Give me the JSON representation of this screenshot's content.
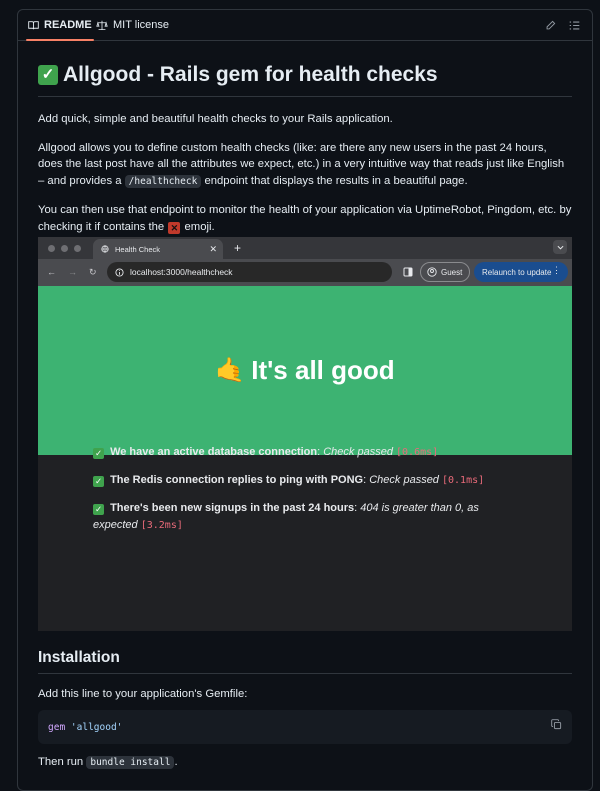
{
  "tabs": {
    "readme": "README",
    "license": "MIT license"
  },
  "readme": {
    "title": "Allgood - Rails gem for health checks",
    "p1": "Add quick, simple and beautiful health checks to your Rails application.",
    "p2a": "Allgood allows you to define custom health checks (like: are there any new users in the past 24 hours, does the last post have all the attributes we expect, etc.) in a very intuitive way that reads just like English – and provides a",
    "p2code": "/healthcheck",
    "p2b": "endpoint that displays the results in a beautiful page.",
    "p3a": "You can then use that endpoint to monitor the health of your application via UptimeRobot, Pingdom, etc. by checking it if contains the",
    "p3b": "emoji."
  },
  "browser": {
    "tab_title": "Health Check",
    "url": "localhost:3000/healthcheck",
    "guest": "Guest",
    "relaunch": "Relaunch to update",
    "banner": "It's all good",
    "checks": [
      {
        "label": "We have an active database connection",
        "message": "Check passed",
        "duration": "[0.6ms]"
      },
      {
        "label": "The Redis connection replies to ping with PONG",
        "message": "Check passed",
        "duration": "[0.1ms]"
      },
      {
        "label": "There's been new signups in the past 24 hours",
        "message": "404 is greater than 0, as expected",
        "duration": "[3.2ms]"
      }
    ]
  },
  "installation": {
    "heading": "Installation",
    "p1": "Add this line to your application's Gemfile:",
    "code_kw": "gem",
    "code_str": "'allgood'",
    "p2a": "Then run",
    "p2code": "bundle install",
    "p2b": "."
  }
}
